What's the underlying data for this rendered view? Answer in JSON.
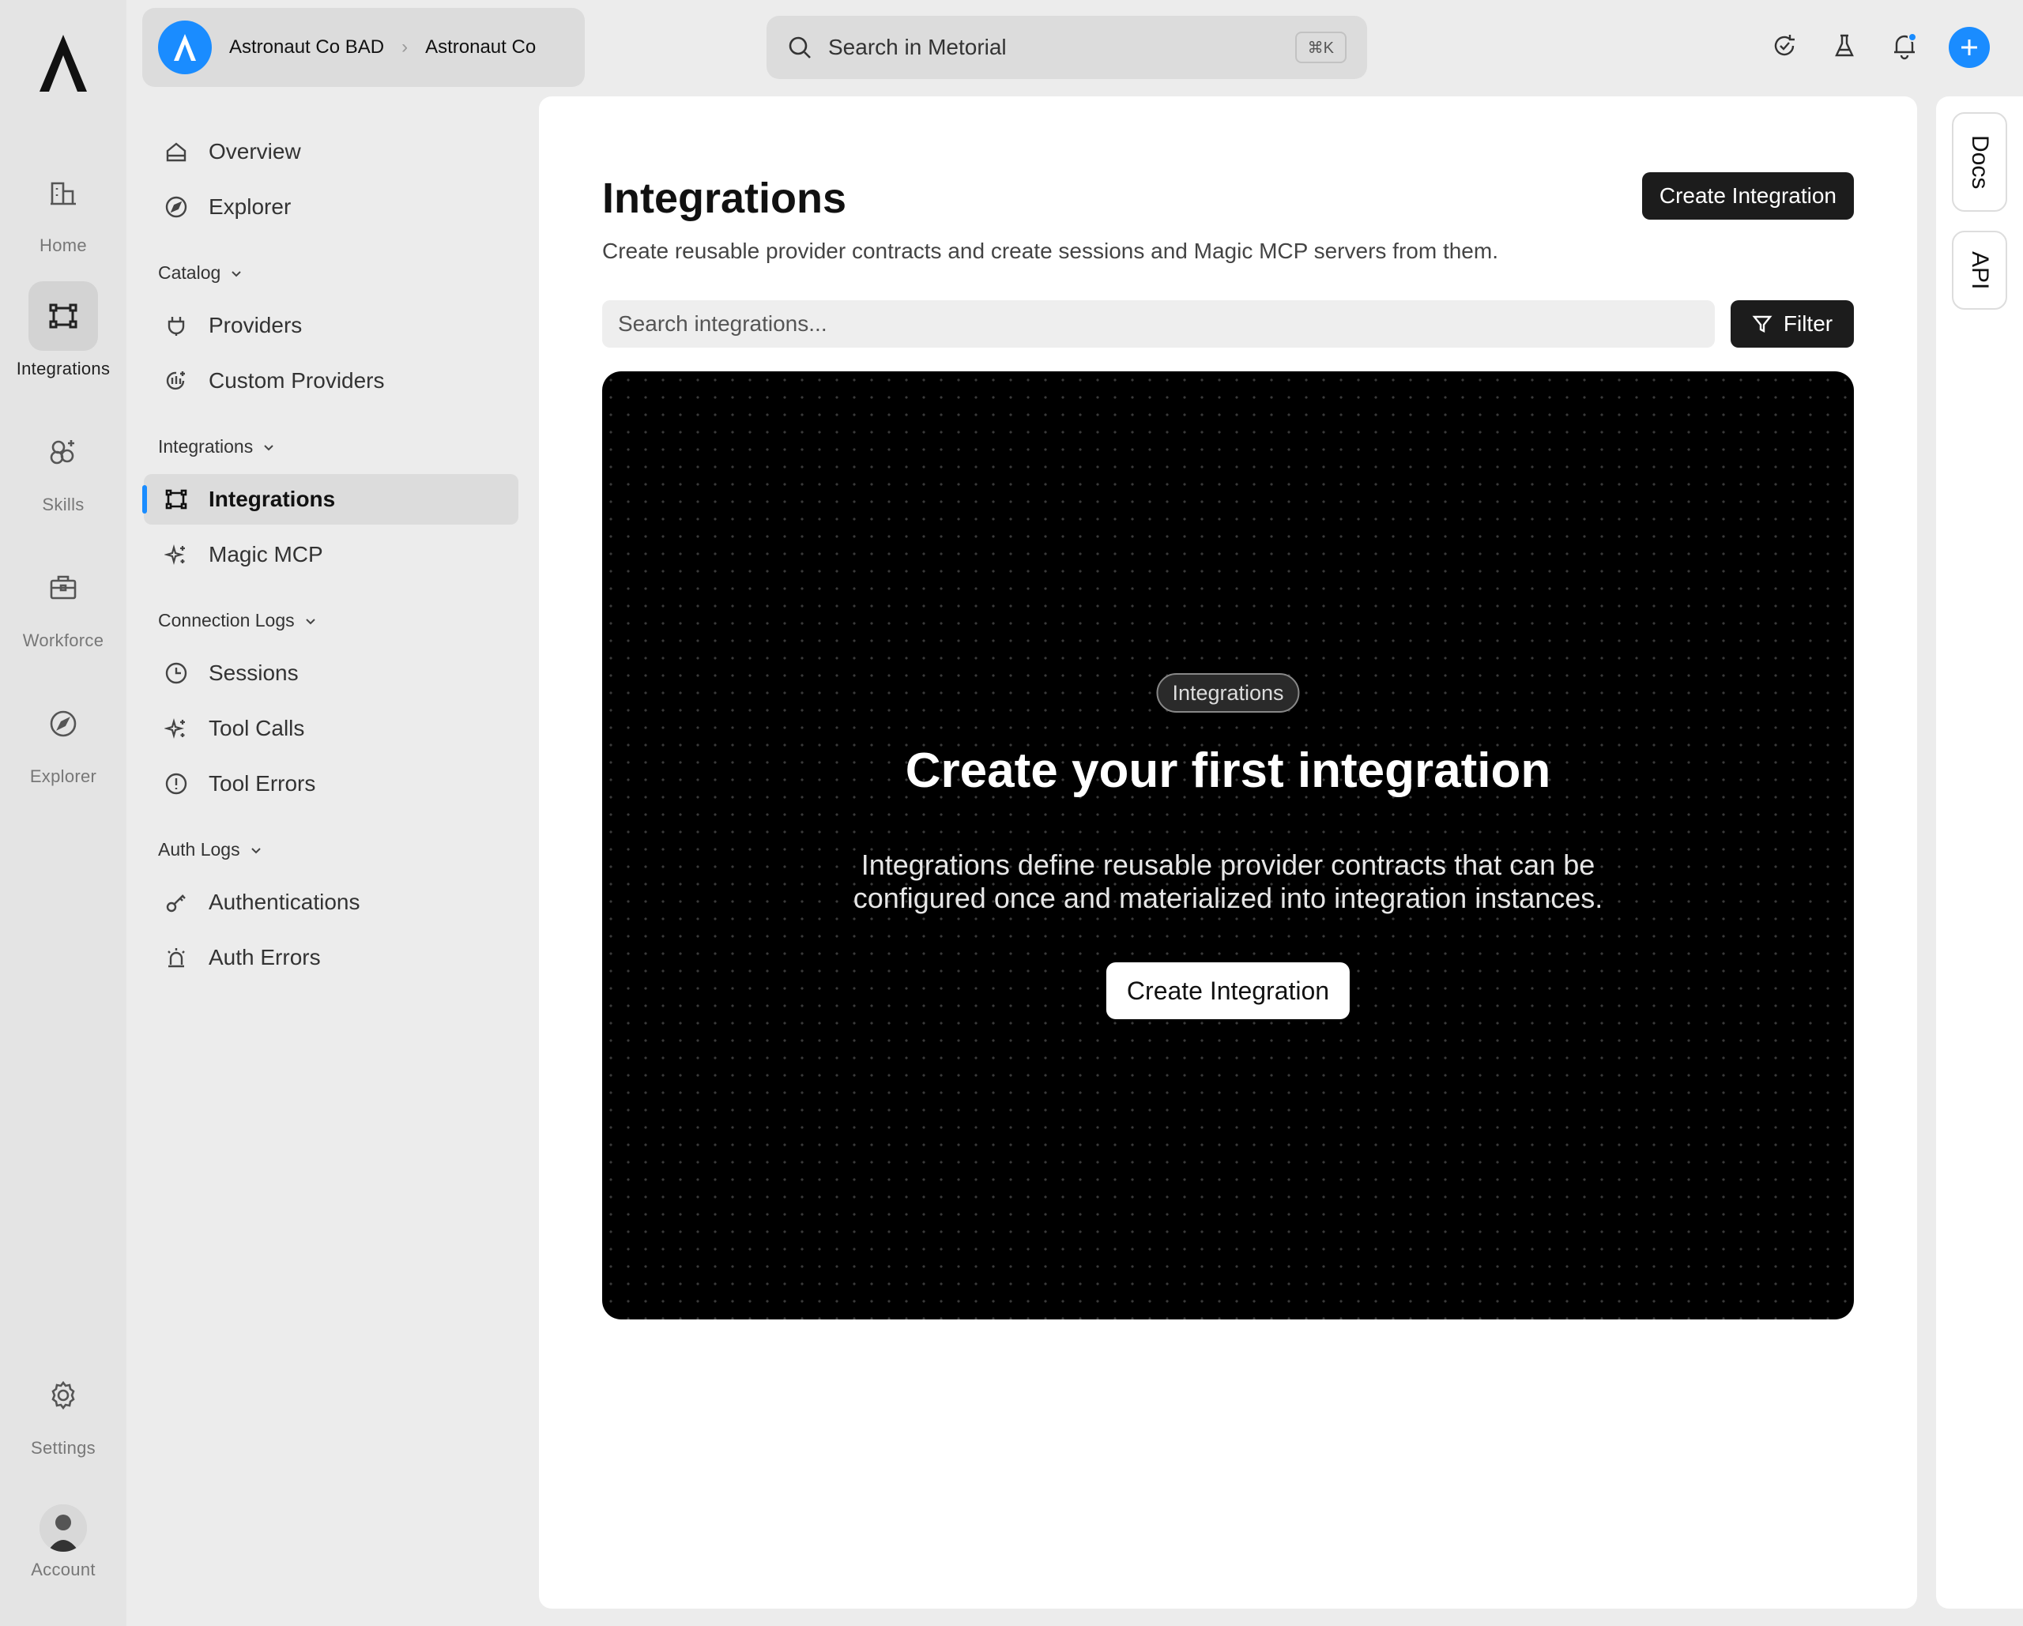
{
  "rail": {
    "items": [
      {
        "label": "Home",
        "icon": "home-icon"
      },
      {
        "label": "Integrations",
        "icon": "integrations-icon",
        "active": true
      },
      {
        "label": "Skills",
        "icon": "skills-icon"
      },
      {
        "label": "Workforce",
        "icon": "workforce-icon"
      },
      {
        "label": "Explorer",
        "icon": "explorer-icon"
      }
    ],
    "settings": "Settings",
    "account": "Account"
  },
  "org": {
    "parent": "Astronaut Co BAD",
    "current": "Astronaut Co"
  },
  "search": {
    "placeholder": "Search in Metorial",
    "shortcut": "⌘K"
  },
  "sidebar": {
    "top_items": [
      {
        "label": "Overview",
        "icon": "overview-icon"
      },
      {
        "label": "Explorer",
        "icon": "explorer-icon"
      }
    ],
    "groups": [
      {
        "title": "Catalog",
        "items": [
          {
            "label": "Providers",
            "icon": "plug-icon"
          },
          {
            "label": "Custom Providers",
            "icon": "custom-provider-icon"
          }
        ]
      },
      {
        "title": "Integrations",
        "items": [
          {
            "label": "Integrations",
            "icon": "integrations-icon",
            "active": true
          },
          {
            "label": "Magic MCP",
            "icon": "sparkle-icon"
          }
        ]
      },
      {
        "title": "Connection Logs",
        "items": [
          {
            "label": "Sessions",
            "icon": "clock-icon"
          },
          {
            "label": "Tool Calls",
            "icon": "sparkle-icon"
          },
          {
            "label": "Tool Errors",
            "icon": "alert-circle-icon"
          }
        ]
      },
      {
        "title": "Auth Logs",
        "items": [
          {
            "label": "Authentications",
            "icon": "key-icon"
          },
          {
            "label": "Auth Errors",
            "icon": "siren-icon"
          }
        ]
      }
    ]
  },
  "page": {
    "title": "Integrations",
    "subtitle": "Create reusable provider contracts and create sessions and Magic MCP servers from them.",
    "create_button": "Create Integration",
    "search_placeholder": "Search integrations...",
    "filter_button": "Filter"
  },
  "empty_state": {
    "badge": "Integrations",
    "title": "Create your first integration",
    "description": "Integrations define reusable provider contracts that can be configured once and materialized into integration instances.",
    "button": "Create Integration"
  },
  "dock": {
    "tabs": [
      "Docs",
      "API"
    ]
  },
  "colors": {
    "accent": "#1a8cff",
    "dark_button": "#1c1c1c",
    "empty_bg": "#000000"
  }
}
